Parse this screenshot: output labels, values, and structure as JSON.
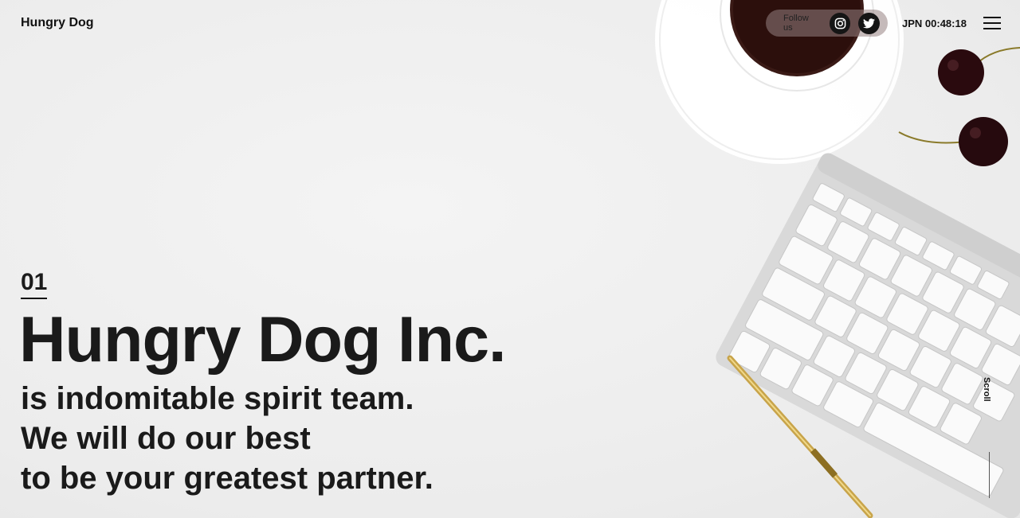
{
  "header": {
    "logo": "Hungry Dog",
    "follow_label": "Follow us",
    "social": [
      {
        "name": "instagram",
        "icon": "instagram-icon"
      },
      {
        "name": "twitter",
        "icon": "twitter-icon"
      }
    ],
    "clock": "JPN 00:48:18",
    "menu_icon": "hamburger-menu-icon"
  },
  "hero": {
    "slide_number": "01",
    "title": "Hungry Dog Inc.",
    "lines": [
      "is indomitable spirit team.",
      "We will do our best",
      "to be your greatest partner."
    ]
  },
  "scroll": {
    "label": "Scroll"
  }
}
